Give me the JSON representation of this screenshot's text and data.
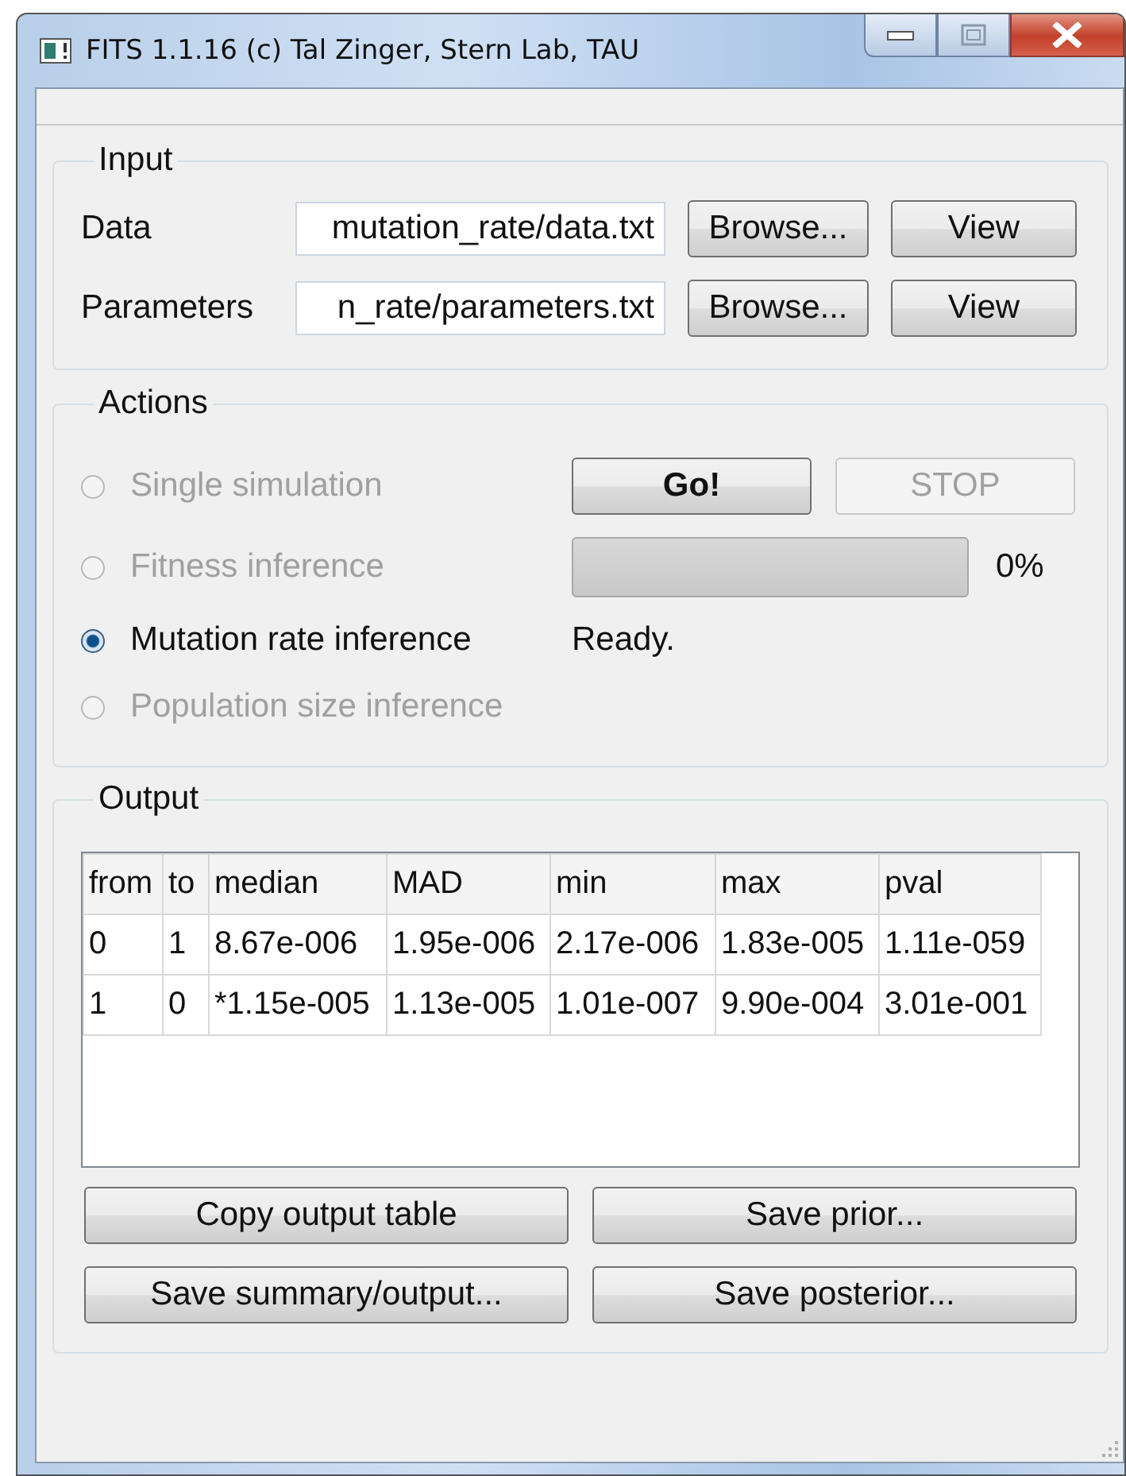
{
  "window": {
    "title": "FITS 1.1.16 (c) Tal Zinger, Stern Lab, TAU"
  },
  "input": {
    "title": "Input",
    "rows": [
      {
        "label": "Data",
        "value": "mutation_rate/data.txt",
        "browse": "Browse...",
        "view": "View"
      },
      {
        "label": "Parameters",
        "value": "n_rate/parameters.txt",
        "browse": "Browse...",
        "view": "View"
      }
    ]
  },
  "actions": {
    "title": "Actions",
    "options": [
      {
        "label": "Single simulation",
        "selected": false,
        "disabled": true
      },
      {
        "label": "Fitness inference",
        "selected": false,
        "disabled": true
      },
      {
        "label": "Mutation rate inference",
        "selected": true,
        "disabled": false
      },
      {
        "label": "Population size inference",
        "selected": false,
        "disabled": true
      }
    ],
    "go_button": {
      "label": "Go!",
      "disabled": false
    },
    "stop_button": {
      "label": "STOP",
      "disabled": true
    },
    "progress": {
      "level": 0,
      "reading": "0%"
    },
    "status": "Ready."
  },
  "output": {
    "title": "Output",
    "table": {
      "columns": [
        "from",
        "to",
        "median",
        "MAD",
        "min",
        "max",
        "pval"
      ],
      "rows": [
        [
          "0",
          "1",
          "8.67e-006",
          "1.95e-006",
          "2.17e-006",
          "1.83e-005",
          "1.11e-059"
        ],
        [
          "1",
          "0",
          "*1.15e-005",
          "1.13e-005",
          "1.01e-007",
          "9.90e-004",
          "3.01e-001"
        ]
      ]
    },
    "buttons": [
      "Copy output table",
      "Save prior...",
      "Save summary/output...",
      "Save posterior..."
    ]
  }
}
